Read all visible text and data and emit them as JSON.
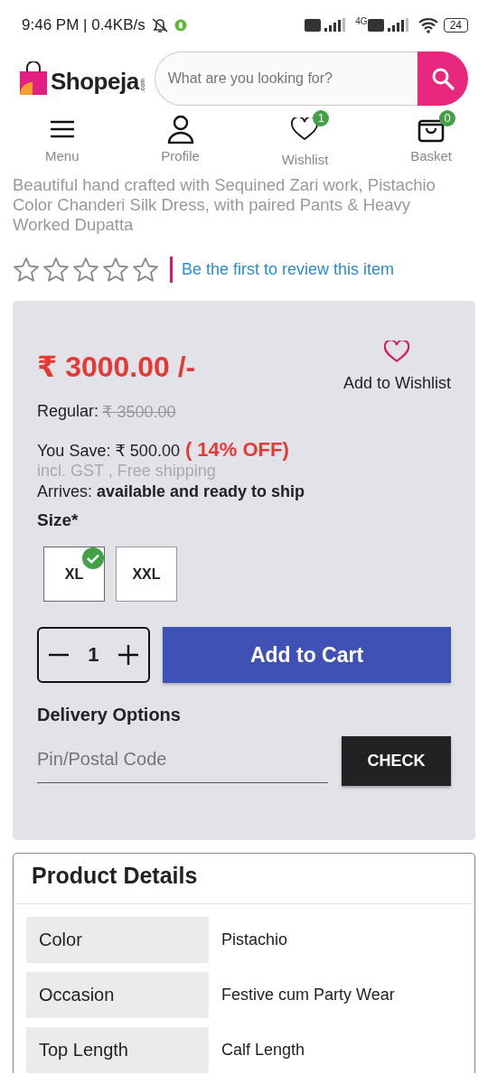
{
  "status_bar": {
    "time": "9:46 PM | 0.4KB/s",
    "network": "4G",
    "battery": "24"
  },
  "header": {
    "logo": "Shopeja",
    "logo_suffix": ".com",
    "search": {
      "placeholder": "What are you looking for?"
    }
  },
  "nav": [
    {
      "label": "Menu"
    },
    {
      "label": "Profile"
    },
    {
      "label": "Wishlist",
      "count": "1"
    },
    {
      "label": "Basket",
      "count": "0"
    }
  ],
  "product": {
    "title": "Beautiful hand crafted with Sequined Zari work, Pistachio Color Chanderi Silk Dress, with paired Pants & Heavy Worked Dupatta",
    "stars": 0,
    "review_link": "Be the first to review this item"
  },
  "price_card": {
    "price": "₹ 3000.00 /-",
    "wishlist": "Add to Wishlist",
    "regular_label": "Regular:",
    "regular_price": "₹ 3500.00",
    "save_label": "You Save: ₹ 500.00",
    "discount": "( 14% OFF)",
    "tax_note": "incl. GST , Free shipping",
    "arrives": "Arrives: **available and ready to ship**",
    "size_label": "Size*",
    "sizes": [
      {
        "label": "XL",
        "selected": true
      },
      {
        "label": "XXL",
        "selected": false
      }
    ],
    "quantity": "1",
    "add_to_cart": "Add to Cart",
    "delivery_title": "Delivery Options",
    "pin": {
      "placeholder": "Pin/Postal Code"
    },
    "check": "CHECK"
  },
  "details": {
    "title": "Product Details",
    "rows": [
      {
        "label": "Color",
        "value": "Pistachio"
      },
      {
        "label": "Occasion",
        "value": "Festive cum Party Wear"
      },
      {
        "label": "Top Length",
        "value": "Calf Length"
      }
    ]
  }
}
